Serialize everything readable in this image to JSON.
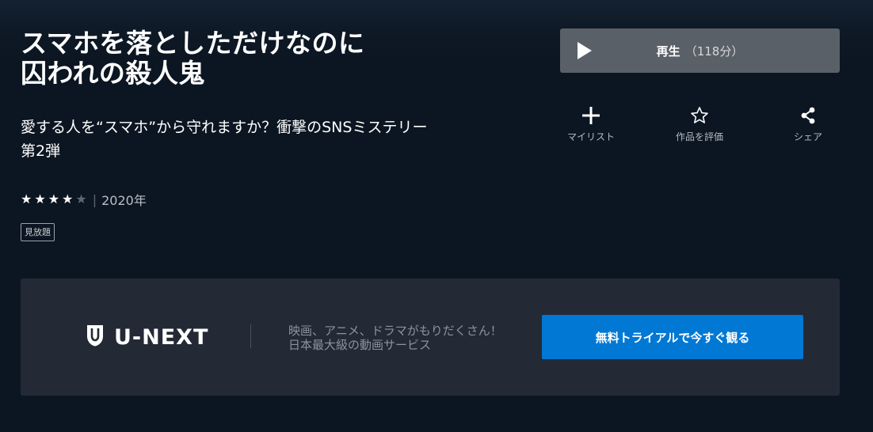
{
  "title": {
    "line1": "スマホを落としただけなのに",
    "line2": "囚われの殺人鬼"
  },
  "tagline": {
    "line1": "愛する人を“スマホ”から守れますか？衝撃のSNSミステリー",
    "line2": "第2弾"
  },
  "rating": {
    "filled": 4,
    "total": 5
  },
  "meta": {
    "separator": "|",
    "year": "2020年"
  },
  "badge": "見放題",
  "play": {
    "label": "再生",
    "duration": "（118分）",
    "icon": "play-icon"
  },
  "actions": [
    {
      "label": "マイリスト",
      "icon": "plus-icon",
      "glyph": "+"
    },
    {
      "label": "作品を評価",
      "icon": "star-outline-icon",
      "glyph": "☆"
    },
    {
      "label": "シェア",
      "icon": "share-icon",
      "glyph": ""
    }
  ],
  "promo": {
    "logo_text": "U-NEXT",
    "line1": "映画、アニメ、ドラマがもりだくさん！",
    "line2": "日本最大級の動画サービス",
    "cta": "無料トライアルで今すぐ観る"
  },
  "colors": {
    "background": "#0c1622",
    "play_button": "#5a6068",
    "promo_panel": "#232a35",
    "cta": "#0078d4"
  }
}
